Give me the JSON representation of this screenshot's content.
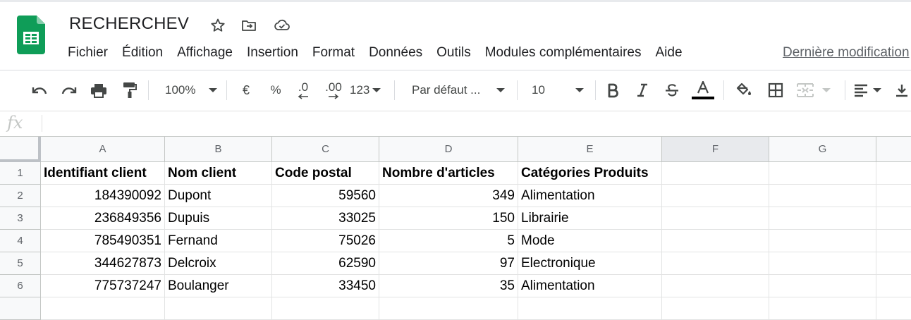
{
  "doc": {
    "title": "RECHERCHEV"
  },
  "menu": [
    "Fichier",
    "Édition",
    "Affichage",
    "Insertion",
    "Format",
    "Données",
    "Outils",
    "Modules complémentaires",
    "Aide"
  ],
  "last_edit": "Dernière modification",
  "toolbar": {
    "zoom": "100%",
    "currency": "€",
    "percent": "%",
    "decrease_decimals": ".0",
    "increase_decimals": ".00",
    "more_formats": "123",
    "font": "Par défaut ...",
    "font_size": "10",
    "text_color_bar": "#000000"
  },
  "formula_bar": {
    "fx_label": "fx",
    "value": ""
  },
  "columns": [
    "A",
    "B",
    "C",
    "D",
    "E",
    "F",
    "G"
  ],
  "rows": [
    "1",
    "2",
    "3",
    "4",
    "5",
    "6"
  ],
  "sheet": {
    "headers": [
      "Identifiant client",
      "Nom client",
      "Code postal",
      "Nombre d'articles",
      "Catégories Produits"
    ],
    "data": [
      [
        "184390092",
        "Dupont",
        "59560",
        "349",
        "Alimentation"
      ],
      [
        "236849356",
        "Dupuis",
        "33025",
        "150",
        "Librairie"
      ],
      [
        "785490351",
        "Fernand",
        "75026",
        "5",
        "Mode"
      ],
      [
        "344627873",
        "Delcroix",
        "62590",
        "97",
        "Electronique"
      ],
      [
        "775737247",
        "Boulanger",
        "33450",
        "35",
        "Alimentation"
      ]
    ]
  },
  "colors": {
    "logo_green": "#0f9d58",
    "accent": "#1a73e8"
  }
}
